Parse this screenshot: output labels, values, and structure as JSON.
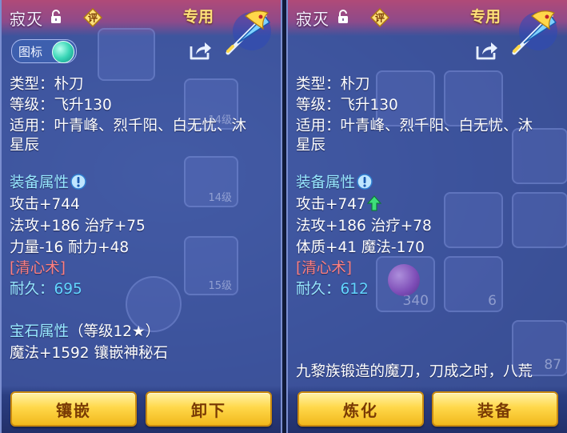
{
  "left_panel": {
    "name": "寂灭",
    "rating_badge": "评",
    "exclusive": "专用",
    "toggle_label": "图标",
    "lines": {
      "type": "类型：朴刀",
      "level": "等级：飞升130",
      "usable_1": "适用：叶青峰、烈千阳、白无忧、沐",
      "usable_2": "星辰",
      "attr_title": "装备属性",
      "attack": "攻击+744",
      "stats_1": "法攻+186 治疗+75",
      "stats_2": "力量-16 耐力+48",
      "skill": "[清心术]",
      "durability_label": "耐久：",
      "durability_value": "695",
      "gem_title": "宝石属性",
      "gem_level": "（等级12★）",
      "gem_stat": "魔法+1592 镶嵌神秘石"
    },
    "buttons": {
      "inlay": "镶嵌",
      "unequip": "卸下"
    }
  },
  "right_panel": {
    "name": "寂灭",
    "rating_badge": "评",
    "exclusive": "专用",
    "lines": {
      "type": "类型：朴刀",
      "level": "等级：飞升130",
      "usable_1": "适用：叶青峰、烈千阳、白无忧、沐",
      "usable_2": "星辰",
      "attr_title": "装备属性",
      "attack": "攻击+747",
      "stats_1": "法攻+186 治疗+78",
      "stats_2": "体质+41 魔法-170",
      "skill": "[清心术]",
      "durability_label": "耐久：",
      "durability_value": "612",
      "description": "九黎族锻造的魔刀，刀成之时，八荒"
    },
    "buttons": {
      "refine": "炼化",
      "equip": "装备"
    }
  },
  "background_hints": {
    "slot_levels": [
      "14级",
      "14级",
      "15级"
    ],
    "item_counts": [
      "340",
      "6",
      "87"
    ]
  },
  "icons": {
    "lock": "unlock-icon",
    "rating": "rating-badge-icon",
    "share": "share-icon",
    "info": "info-icon",
    "up": "up-arrow-icon",
    "weapon": "dragon-blade-icon"
  },
  "colors": {
    "section_title": "#98e8ff",
    "skill": "#ff8080",
    "durability_value": "#62d6ff",
    "button_gold": "#ffd84a",
    "button_text": "#7a3b05",
    "up_arrow": "#3ee07a"
  }
}
